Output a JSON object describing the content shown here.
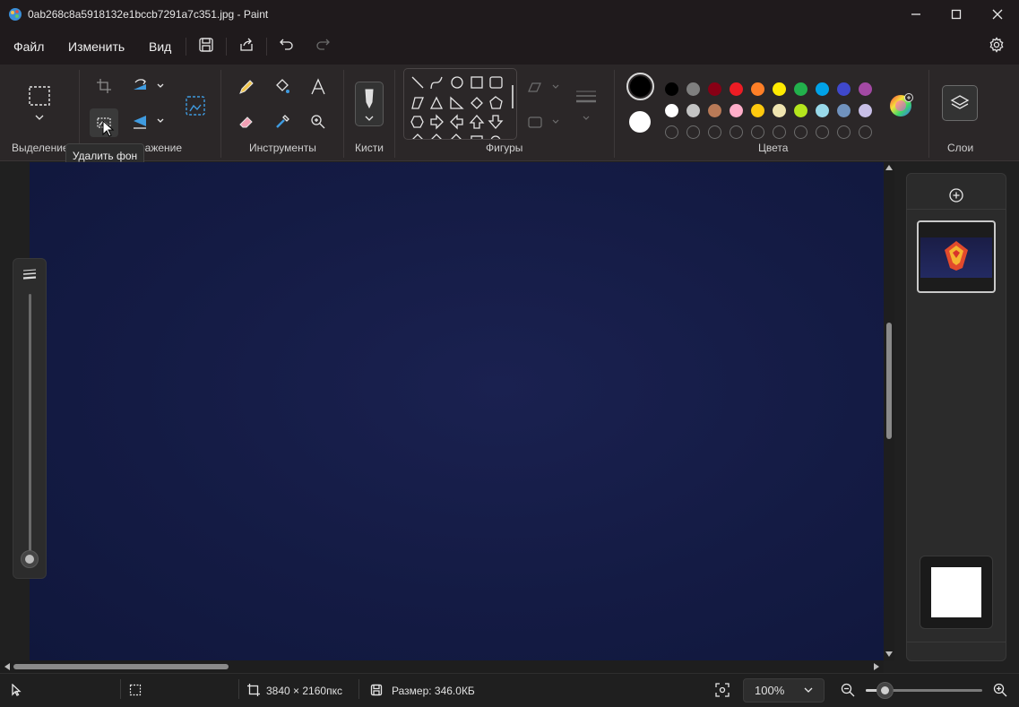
{
  "window": {
    "title": "0ab268c8a5918132e1bccb7291a7c351.jpg - Paint",
    "minimize_icon": "minimize-icon",
    "maximize_icon": "maximize-icon",
    "close_icon": "close-icon"
  },
  "menu": {
    "file": "Файл",
    "edit": "Изменить",
    "view": "Вид",
    "icons": [
      "save-icon",
      "share-icon",
      "undo-icon",
      "redo-icon",
      "settings-icon"
    ]
  },
  "ribbon": {
    "groups": {
      "selection": "Выделение",
      "image": "ражение",
      "tools": "Инструменты",
      "brushes": "Кисти",
      "shapes": "Фигуры",
      "colors": "Цвета",
      "layers": "Слои"
    },
    "tools": [
      "pencil-icon",
      "fill-icon",
      "text-icon",
      "eraser-icon",
      "color-picker-icon",
      "magnifier-icon"
    ],
    "shapes": [
      "line",
      "curve",
      "oval",
      "rectangle",
      "rounded-rectangle",
      "polygon",
      "triangle",
      "right-triangle",
      "diamond",
      "pentagon",
      "hexagon",
      "arrow-right",
      "arrow-left",
      "arrow-up",
      "arrow-down"
    ],
    "colors": {
      "primary": "#000000",
      "secondary": "#ffffff",
      "row1": [
        "#000000",
        "#7f7f7f",
        "#880015",
        "#ed1c24",
        "#ff7f27",
        "#ffea00",
        "#22b14c",
        "#00a2e8",
        "#3f48cc",
        "#a349a4"
      ],
      "row2": [
        "#ffffff",
        "#c3c3c3",
        "#b97a57",
        "#ffaec9",
        "#ffc90e",
        "#efe4b0",
        "#b5e61d",
        "#99d9ea",
        "#7092be",
        "#c8bfe7"
      ],
      "row3_empty_count": 10
    }
  },
  "tooltip": {
    "text": "Удалить фон"
  },
  "status": {
    "dimensions": "3840 × 2160пкс",
    "size": "Размер: 346.0КБ",
    "zoom": "100%",
    "zoom_level": 0.17
  }
}
